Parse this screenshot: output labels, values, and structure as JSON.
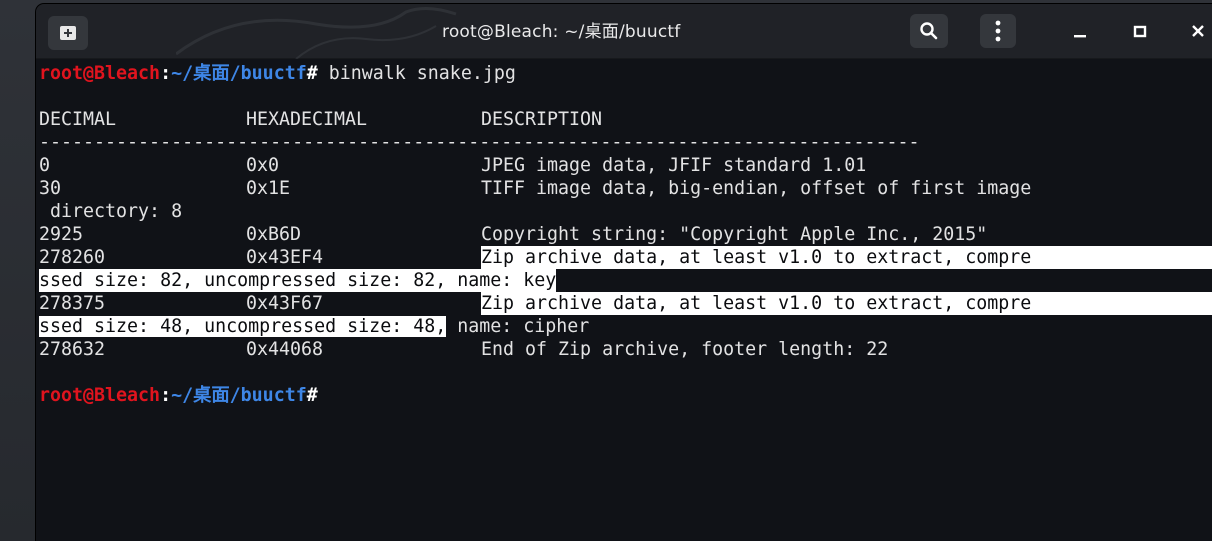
{
  "window": {
    "title": "root@Bleach: ~/桌面/buuctf"
  },
  "prompt": {
    "user_host": "root@Bleach",
    "colon": ":",
    "path": "~/桌面/buuctf",
    "hash": "#",
    "command": " binwalk snake.jpg"
  },
  "headers": {
    "decimal": "DECIMAL",
    "hexadecimal": "HEXADECIMAL",
    "description": "DESCRIPTION",
    "separator": "--------------------------------------------------------------------------------"
  },
  "rows": [
    {
      "decimal": "0",
      "hex": "0x0",
      "desc": "JPEG image data, JFIF standard 1.01"
    },
    {
      "decimal": "30",
      "hex": "0x1E",
      "desc": "TIFF image data, big-endian, offset of first image"
    },
    {
      "wrap": " directory: 8"
    },
    {
      "decimal": "2925",
      "hex": "0xB6D",
      "desc": "Copyright string: \"Copyright Apple Inc., 2015\""
    },
    {
      "decimal": "278260",
      "hex": "0x43EF4",
      "desc": "Zip archive data, at least v1.0 to extract, compre"
    },
    {
      "wrap": "ssed size: 82, uncompressed size: 82, name: key"
    },
    {
      "decimal": "278375",
      "hex": "0x43F67",
      "desc": "Zip archive data, at least v1.0 to extract, compre"
    },
    {
      "wrap_a": "ssed size: 48, uncompressed size: 48,",
      "wrap_b": " name: cipher"
    },
    {
      "decimal": "278632",
      "hex": "0x44068",
      "desc": "End of Zip archive, footer length: 22"
    }
  ],
  "icons": {
    "new_tab": "new-tab-icon",
    "search": "search-icon",
    "menu": "kebab-menu-icon",
    "minimize": "minimize-icon",
    "maximize": "maximize-icon",
    "close": "close-icon"
  }
}
